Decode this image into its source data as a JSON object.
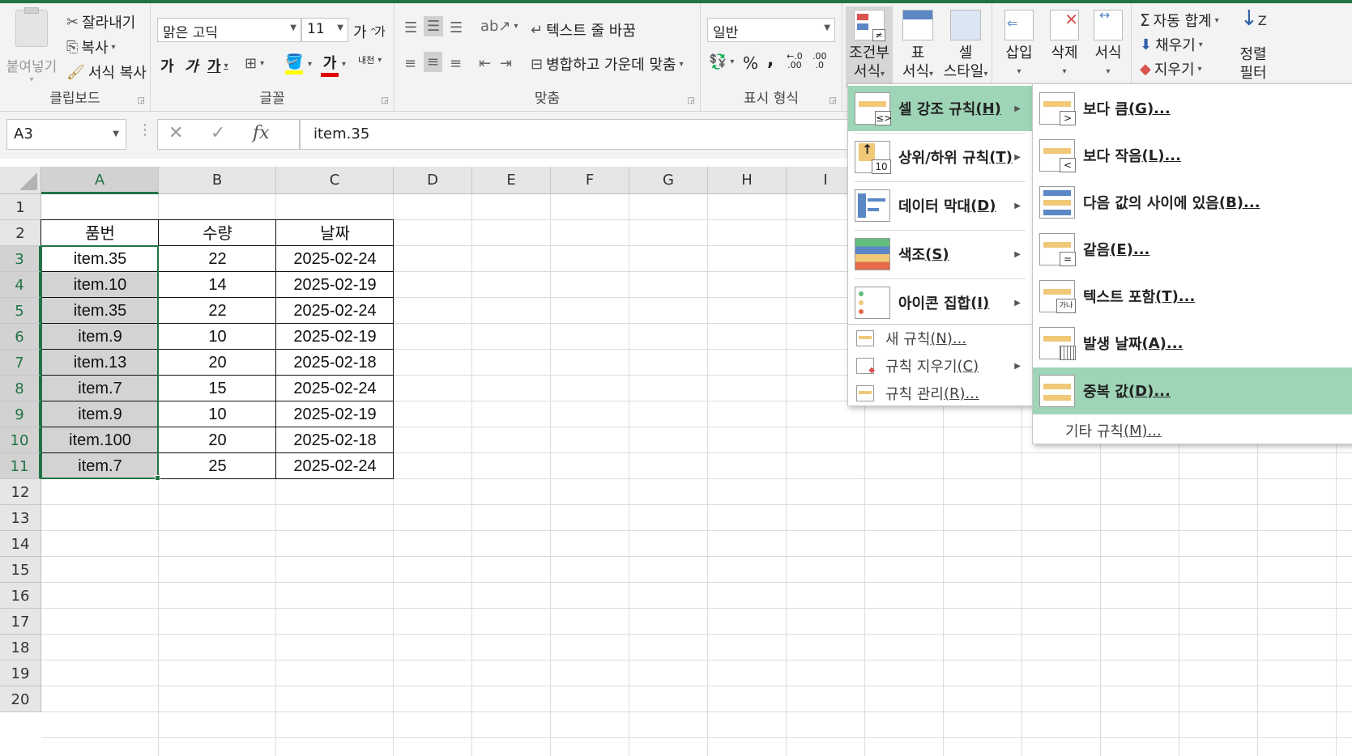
{
  "ribbon": {
    "clipboard": {
      "paste": "붙여넣기",
      "cut": "잘라내기",
      "copy": "복사",
      "format_painter": "서식 복사",
      "label": "클립보드"
    },
    "font": {
      "name": "맑은 고딕",
      "size": "11",
      "grow": "가",
      "shrink": "가",
      "bold": "가",
      "italic": "가",
      "underline": "가",
      "font_color": "가",
      "phonetic": "내천",
      "label": "글꼴"
    },
    "alignment": {
      "wrap_text": "텍스트 줄 바꿈",
      "merge_center": "병합하고 가운데 맞춤",
      "label": "맞춤"
    },
    "number": {
      "format": "일반",
      "percent": "%",
      "comma": ",",
      "inc_decimal": ".00",
      "dec_decimal": ".0",
      "label": "표시 형식"
    },
    "styles": {
      "conditional": [
        "조건부",
        "서식"
      ],
      "format_table": [
        "표",
        "서식"
      ],
      "cell_styles": [
        "셀",
        "스타일"
      ]
    },
    "cells": {
      "insert": "삽입",
      "delete": "삭제",
      "format": "서식"
    },
    "editing": {
      "autosum": "자동 합계",
      "fill": "채우기",
      "clear": "지우기",
      "sort_filter": [
        "정렬",
        "필터"
      ]
    }
  },
  "formula_bar": {
    "name_box": "A3",
    "formula": "item.35",
    "fx": "fx"
  },
  "sheet": {
    "columns": [
      "A",
      "B",
      "C",
      "D",
      "E",
      "F",
      "G",
      "H",
      "I"
    ],
    "rows": [
      "1",
      "2",
      "3",
      "4",
      "5",
      "6",
      "7",
      "8",
      "9",
      "10",
      "11",
      "12",
      "13",
      "14",
      "15",
      "16",
      "17",
      "18",
      "19",
      "20"
    ],
    "headers": [
      "품번",
      "수량",
      "날짜"
    ],
    "data": [
      [
        "item.35",
        "22",
        "2025-02-24"
      ],
      [
        "item.10",
        "14",
        "2025-02-19"
      ],
      [
        "item.35",
        "22",
        "2025-02-24"
      ],
      [
        "item.9",
        "10",
        "2025-02-19"
      ],
      [
        "item.13",
        "20",
        "2025-02-18"
      ],
      [
        "item.7",
        "15",
        "2025-02-24"
      ],
      [
        "item.9",
        "10",
        "2025-02-19"
      ],
      [
        "item.100",
        "20",
        "2025-02-18"
      ],
      [
        "item.7",
        "25",
        "2025-02-24"
      ]
    ]
  },
  "cf_menu": {
    "items": [
      {
        "label": "셀 강조 규칙",
        "key": "(H)"
      },
      {
        "label": "상위/하위 규칙",
        "key": "(T)"
      },
      {
        "label": "데이터 막대",
        "key": "(D)"
      },
      {
        "label": "색조",
        "key": "(S)"
      },
      {
        "label": "아이콘 집합",
        "key": "(I)"
      }
    ],
    "small_items": [
      {
        "label": "새 규칙",
        "key": "(N)..."
      },
      {
        "label": "규칙 지우기",
        "key": "(C)"
      },
      {
        "label": "규칙 관리",
        "key": "(R)..."
      }
    ]
  },
  "highlight_menu": {
    "items": [
      {
        "label": "보다 큼",
        "key": "(G)..."
      },
      {
        "label": "보다 작음",
        "key": "(L)..."
      },
      {
        "label": "다음 값의 사이에 있음",
        "key": "(B)..."
      },
      {
        "label": "같음",
        "key": "(E)..."
      },
      {
        "label": "텍스트 포함",
        "key": "(T)..."
      },
      {
        "label": "발생 날짜",
        "key": "(A)..."
      },
      {
        "label": "중복 값",
        "key": "(D)..."
      }
    ],
    "more": {
      "label": "기타 규칙",
      "key": "(M)..."
    }
  },
  "colors": {
    "accent": "#217346",
    "menu_highlight": "#9fd5b7",
    "selected_range": "#d3d3d3"
  },
  "icons": [
    "scissors-icon",
    "copy-icon",
    "brush-icon",
    "paste-icon",
    "sigma-icon",
    "fill-down-icon",
    "eraser-icon",
    "cancel-icon",
    "check-icon",
    "fx-icon"
  ]
}
